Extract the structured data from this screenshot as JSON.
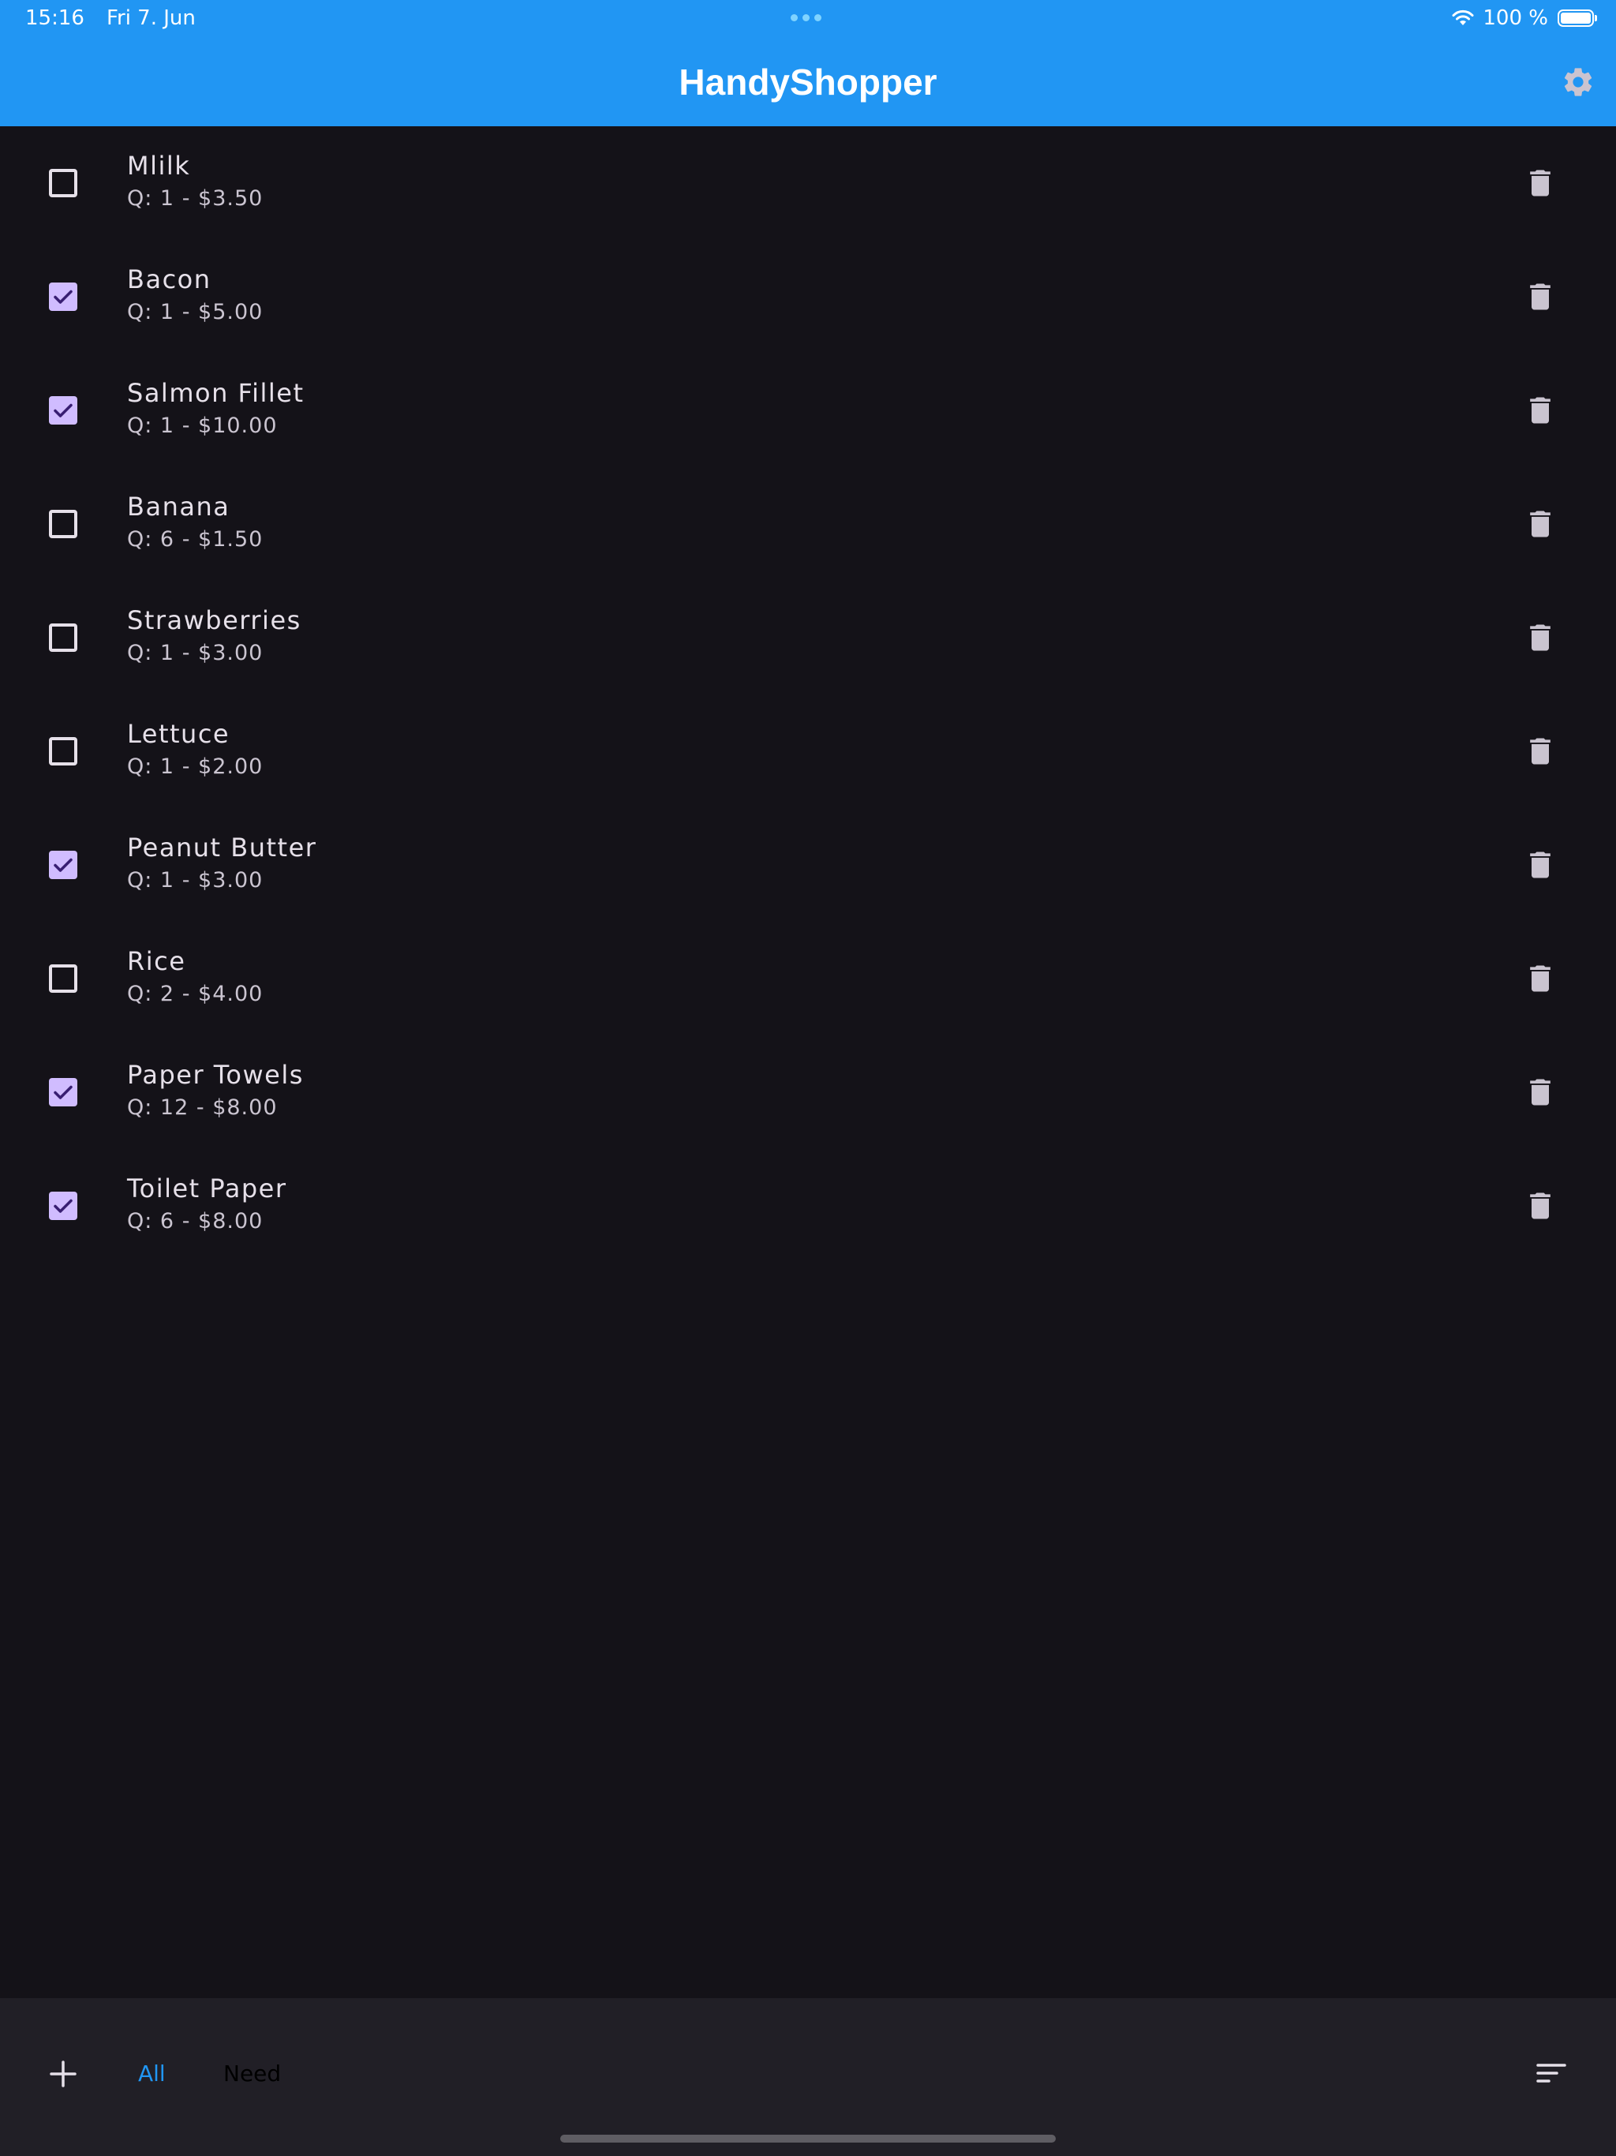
{
  "status_bar": {
    "time": "15:16",
    "date": "Fri 7. Jun",
    "battery": "100 %"
  },
  "app_bar": {
    "title": "HandyShopper",
    "settings_icon": "gear-icon"
  },
  "items": [
    {
      "name": "Mlilk",
      "detail": "Q: 1 - $3.50",
      "checked": false
    },
    {
      "name": "Bacon",
      "detail": "Q: 1 - $5.00",
      "checked": true
    },
    {
      "name": "Salmon Fillet",
      "detail": "Q: 1 - $10.00",
      "checked": true
    },
    {
      "name": "Banana",
      "detail": "Q: 6 - $1.50",
      "checked": false
    },
    {
      "name": "Strawberries",
      "detail": "Q: 1 - $3.00",
      "checked": false
    },
    {
      "name": "Lettuce",
      "detail": "Q: 1 - $2.00",
      "checked": false
    },
    {
      "name": "Peanut Butter",
      "detail": "Q: 1 - $3.00",
      "checked": true
    },
    {
      "name": "Rice",
      "detail": "Q: 2 - $4.00",
      "checked": false
    },
    {
      "name": "Paper Towels",
      "detail": "Q: 12 - $8.00",
      "checked": true
    },
    {
      "name": "Toilet Paper",
      "detail": "Q: 6 - $8.00",
      "checked": true
    }
  ],
  "bottom_bar": {
    "add_icon": "plus-icon",
    "filters": [
      {
        "label": "All",
        "selected": true
      },
      {
        "label": "Need",
        "selected": false
      }
    ],
    "sort_icon": "sort-icon"
  },
  "colors": {
    "app_bar": "#2196F3",
    "background": "#141218",
    "checkbox_checked": "#D0BCFF",
    "bottom_bar": "#211F26",
    "selected_filter": "#2196F3"
  }
}
